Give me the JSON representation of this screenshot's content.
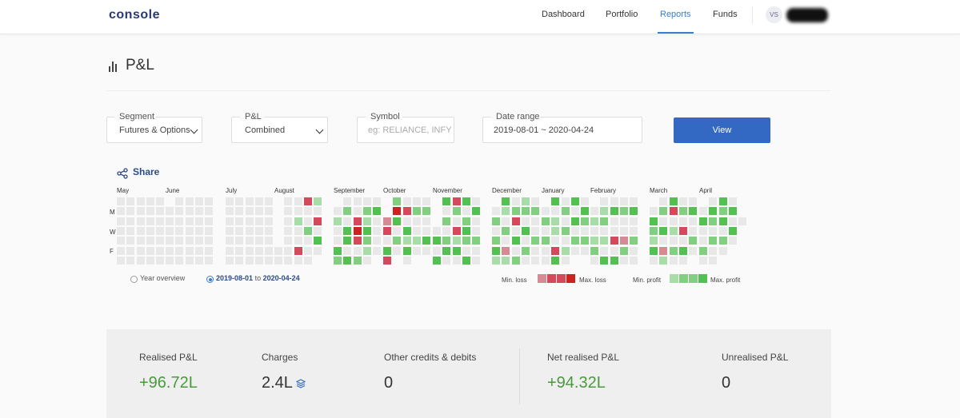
{
  "header": {
    "logo": "console",
    "nav": [
      {
        "label": "Dashboard",
        "active": false
      },
      {
        "label": "Portfolio",
        "active": false
      },
      {
        "label": "Reports",
        "active": true
      },
      {
        "label": "Funds",
        "active": false
      }
    ],
    "avatar_initials": "VS"
  },
  "page": {
    "title": "P&L"
  },
  "filters": {
    "segment": {
      "label": "Segment",
      "value": "Futures & Options"
    },
    "pnl": {
      "label": "P&L",
      "value": "Combined"
    },
    "symbol": {
      "label": "Symbol",
      "placeholder": "eg: RELIANCE, INFY"
    },
    "date_range": {
      "label": "Date range",
      "value": "2019-08-01 ~ 2020-04-24"
    },
    "view_button": "View"
  },
  "share_label": "Share",
  "heatmap": {
    "months": [
      "May",
      "June",
      "July",
      "August",
      "September",
      "October",
      "November",
      "December",
      "January",
      "February",
      "March",
      "April"
    ],
    "day_labels": [
      "M",
      "W",
      "F"
    ],
    "colors": {
      "empty": "#e8e8e8",
      "loss_min": "#d88a94",
      "loss_mid": "#d44a5c",
      "loss_max": "#cc2222",
      "profit_min": "#a8dca8",
      "profit_mid": "#82cf82",
      "profit_max": "#52c152"
    }
  },
  "range_options": {
    "year_overview": "Year overview",
    "range_from": "2019-08-01",
    "range_to_word": "to",
    "range_to": "2020-04-24"
  },
  "legend": {
    "min_loss": "Min. loss",
    "max_loss": "Max. loss",
    "min_profit": "Min. profit",
    "max_profit": "Max. profit"
  },
  "summary": [
    {
      "label": "Realised P&L",
      "value": "+96.72L",
      "positive": true
    },
    {
      "label": "Charges",
      "value": "2.4L",
      "positive": false
    },
    {
      "label": "Other credits & debits",
      "value": "0",
      "positive": false
    },
    {
      "label": "Net realised P&L",
      "value": "+94.32L",
      "positive": true
    },
    {
      "label": "Unrealised P&L",
      "value": "0",
      "positive": false
    }
  ]
}
